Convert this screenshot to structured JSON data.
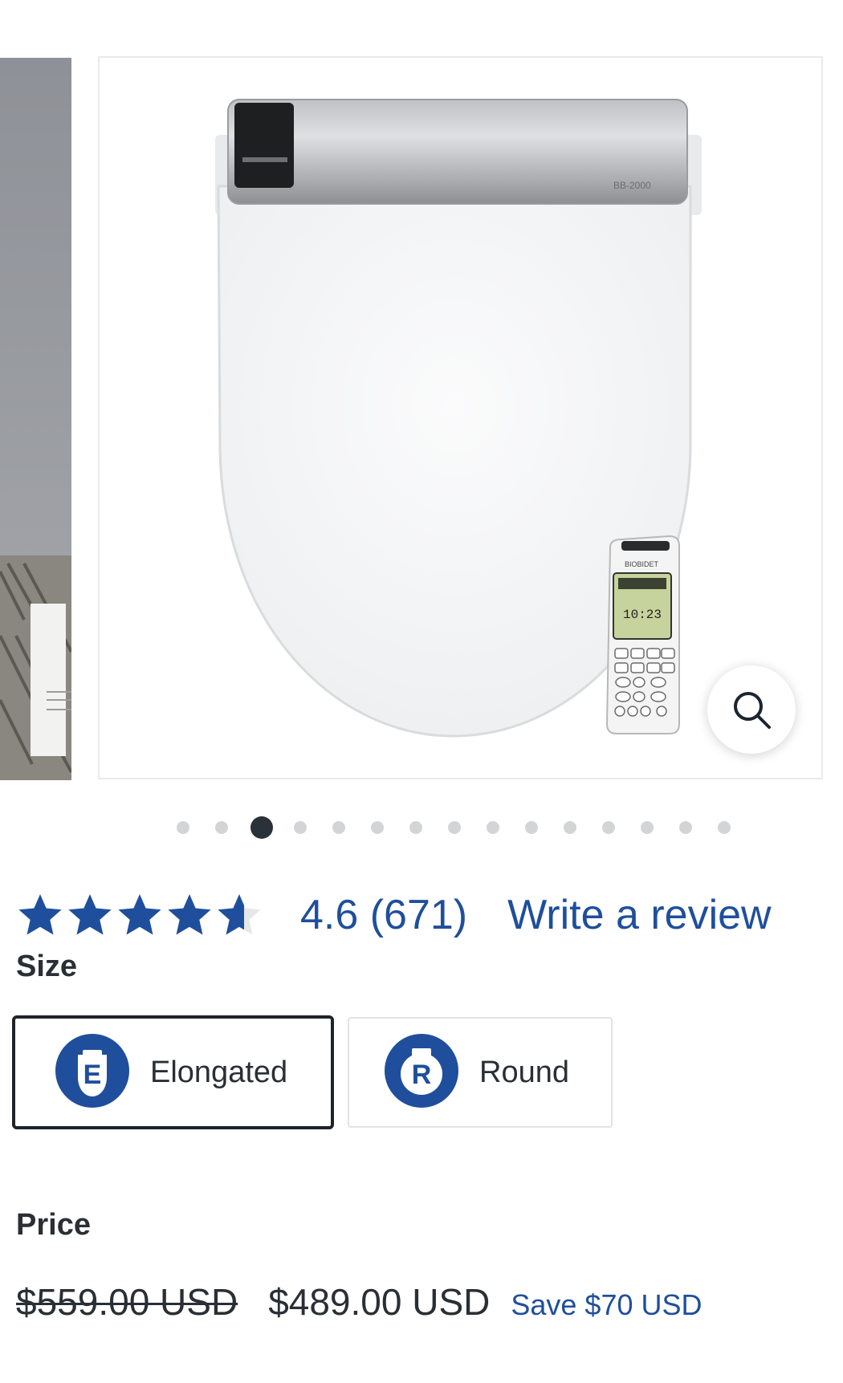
{
  "gallery": {
    "dot_count": 15,
    "active_index": 2,
    "product_model": "BB-2000",
    "remote_brand": "BIOBIDET",
    "remote_time": "10:23"
  },
  "reviews": {
    "rating": "4.6 (671)",
    "rating_value": 4.6,
    "write_review_label": "Write a review"
  },
  "size": {
    "label": "Size",
    "options": [
      {
        "badge": "E",
        "label": "Elongated",
        "selected": true
      },
      {
        "badge": "R",
        "label": "Round",
        "selected": false
      }
    ]
  },
  "price": {
    "label": "Price",
    "original": "$559.00 USD",
    "current": "$489.00 USD",
    "savings": "Save $70 USD"
  },
  "colors": {
    "accent": "#1f4f9c",
    "text": "#2a2f35"
  }
}
